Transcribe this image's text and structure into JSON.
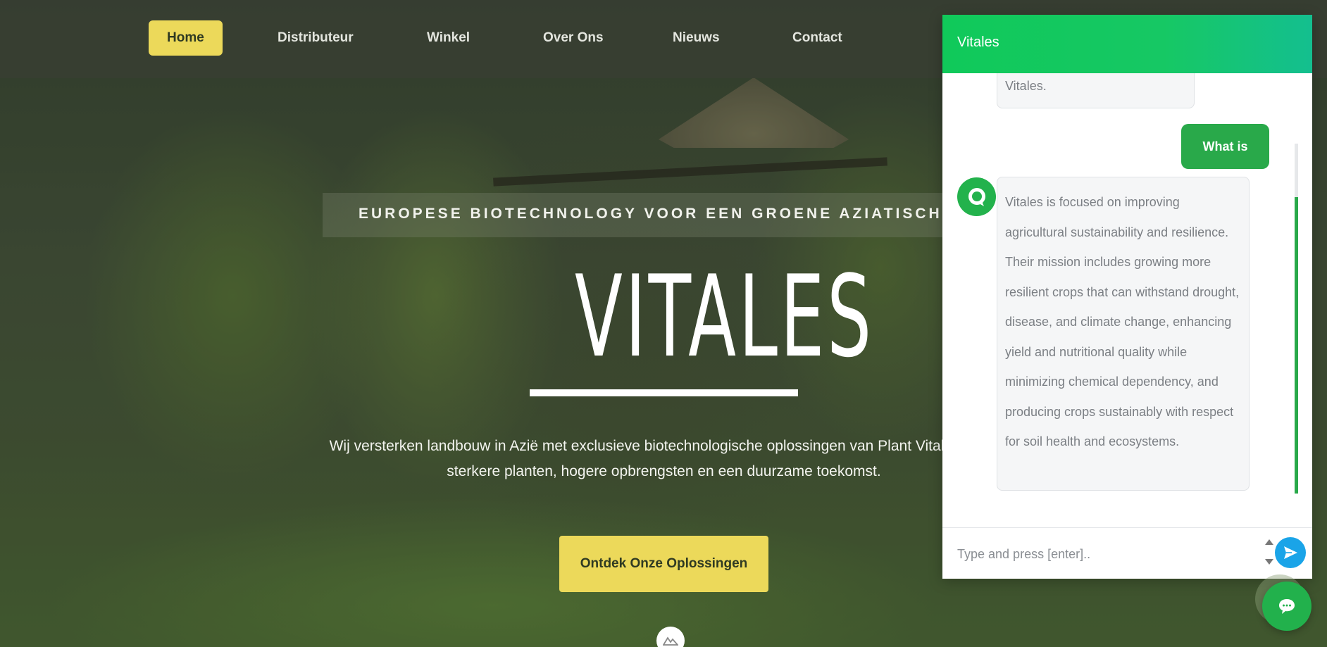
{
  "nav": {
    "items": [
      {
        "label": "Home",
        "active": true
      },
      {
        "label": "Distributeur"
      },
      {
        "label": "Winkel"
      },
      {
        "label": "Over Ons"
      },
      {
        "label": "Nieuws"
      },
      {
        "label": "Contact"
      }
    ]
  },
  "hero": {
    "tagline": "EUROPESE BIOTECHNOLOGY VOOR EEN GROENE AZIATISCHE TOEKOMST",
    "brand": "VITALES",
    "text": "Wij versterken landbouw in Azië met exclusieve biotechnologische oplossingen van Plant Vitales. Voor sterkere planten, hogere opbrengsten en een duurzame toekomst.",
    "cta_label": "Ontdek Onze Oplossingen"
  },
  "chat": {
    "title": "Vitales",
    "previous_message_tail": "Vitales.",
    "user_message": "What is Vitales?",
    "bot_message": "Vitales is focused on improving agricultural sustainability and resilience. Their mission includes growing more resilient crops that can withstand drought, disease, and climate change, enhancing yield and nutritional quality while minimizing chemical dependency, and producing crops sustainably with respect for soil health and ecosystems.",
    "input_placeholder": "Type and press [enter]..",
    "icons": {
      "avatar": "chat-bubble-icon",
      "send": "send-arrow-icon",
      "launcher": "chat-icon"
    }
  },
  "colors": {
    "accent_yellow": "#ecd95a",
    "chat_green": "#29a94a",
    "header_green": "#10c95a",
    "send_blue": "#1aa4e8"
  }
}
